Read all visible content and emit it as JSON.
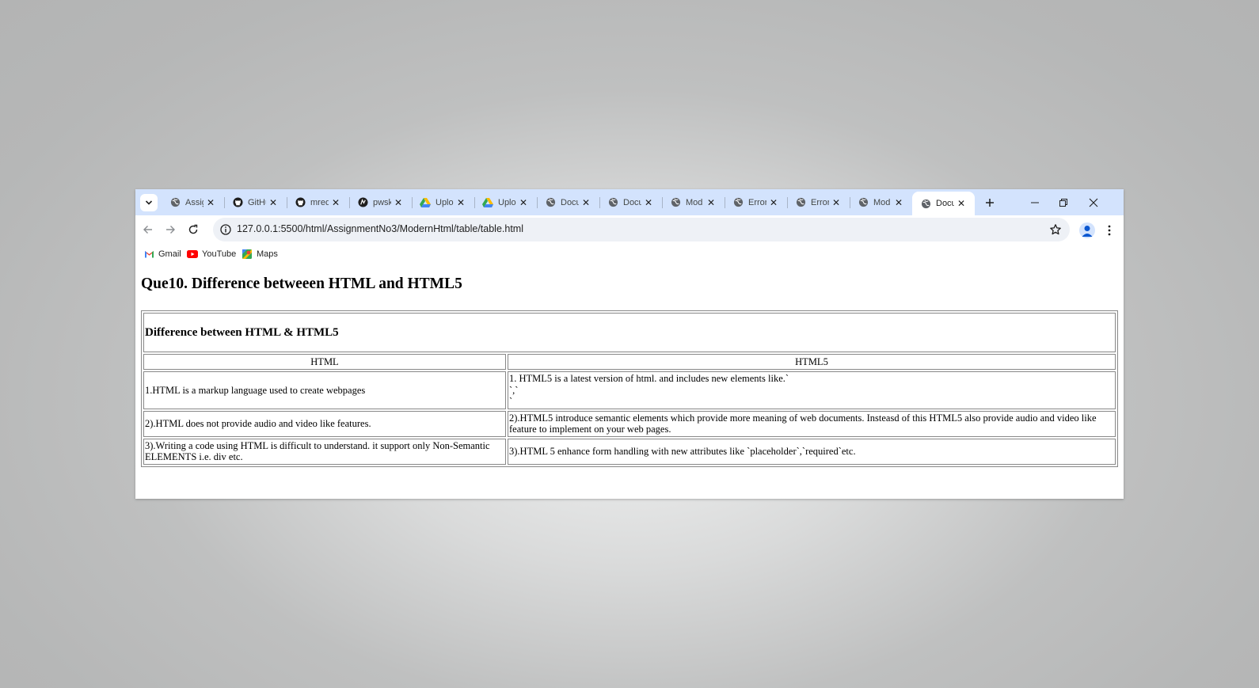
{
  "browser": {
    "tabs": [
      {
        "title": "Assig",
        "icon": "globe-icon",
        "active": false
      },
      {
        "title": "GitHu",
        "icon": "github-icon",
        "active": false
      },
      {
        "title": "mred",
        "icon": "github-icon",
        "active": false
      },
      {
        "title": "pwsk",
        "icon": "pw-icon",
        "active": false
      },
      {
        "title": "Uplo",
        "icon": "google-drive-icon",
        "active": false
      },
      {
        "title": "Uplo",
        "icon": "google-drive-icon",
        "active": false
      },
      {
        "title": "Docu",
        "icon": "globe-icon",
        "active": false
      },
      {
        "title": "Docu",
        "icon": "globe-icon",
        "active": false
      },
      {
        "title": "Mod",
        "icon": "globe-icon",
        "active": false
      },
      {
        "title": "Error",
        "icon": "globe-icon",
        "active": false
      },
      {
        "title": "Error",
        "icon": "globe-icon",
        "active": false
      },
      {
        "title": "Mod",
        "icon": "globe-icon",
        "active": false
      },
      {
        "title": "Docu",
        "icon": "globe-icon",
        "active": true
      }
    ],
    "url": "127.0.0.1:5500/html/AssignmentNo3/ModernHtml/table/table.html",
    "bookmarks": [
      {
        "label": "Gmail",
        "icon": "gmail-icon"
      },
      {
        "label": "YouTube",
        "icon": "youtube-icon"
      },
      {
        "label": "Maps",
        "icon": "maps-icon"
      }
    ],
    "colors": {
      "tabstrip": "#d3e3fd",
      "omnibox": "#eef1f6"
    }
  },
  "page": {
    "heading": "Que10. Difference betweeen HTML and HTML5",
    "table": {
      "caption": "Difference between HTML & HTML5",
      "headers": [
        "HTML",
        "HTML5"
      ],
      "rows": [
        {
          "html": "1.HTML is a markup language used to create webpages",
          "html5": [
            "1. HTML5 is a latest version of html. and includes new elements like.`",
            "`,`",
            "`"
          ]
        },
        {
          "html": "2).HTML does not provide audio and video like features.",
          "html5": [
            "2).HTML5 introduce semantic elements which provide more meaning of web documents. Insteasd of this HTML5 also provide audio and video like feature to implement on your web pages."
          ]
        },
        {
          "html": "3).Writing a code using HTML is difficult to understand. it support only Non-Semantic ELEMENTS i.e. div etc.",
          "html5": [
            "3).HTML 5 enhance form handling with new attributes like `placeholder`,`required`etc."
          ]
        }
      ]
    }
  }
}
